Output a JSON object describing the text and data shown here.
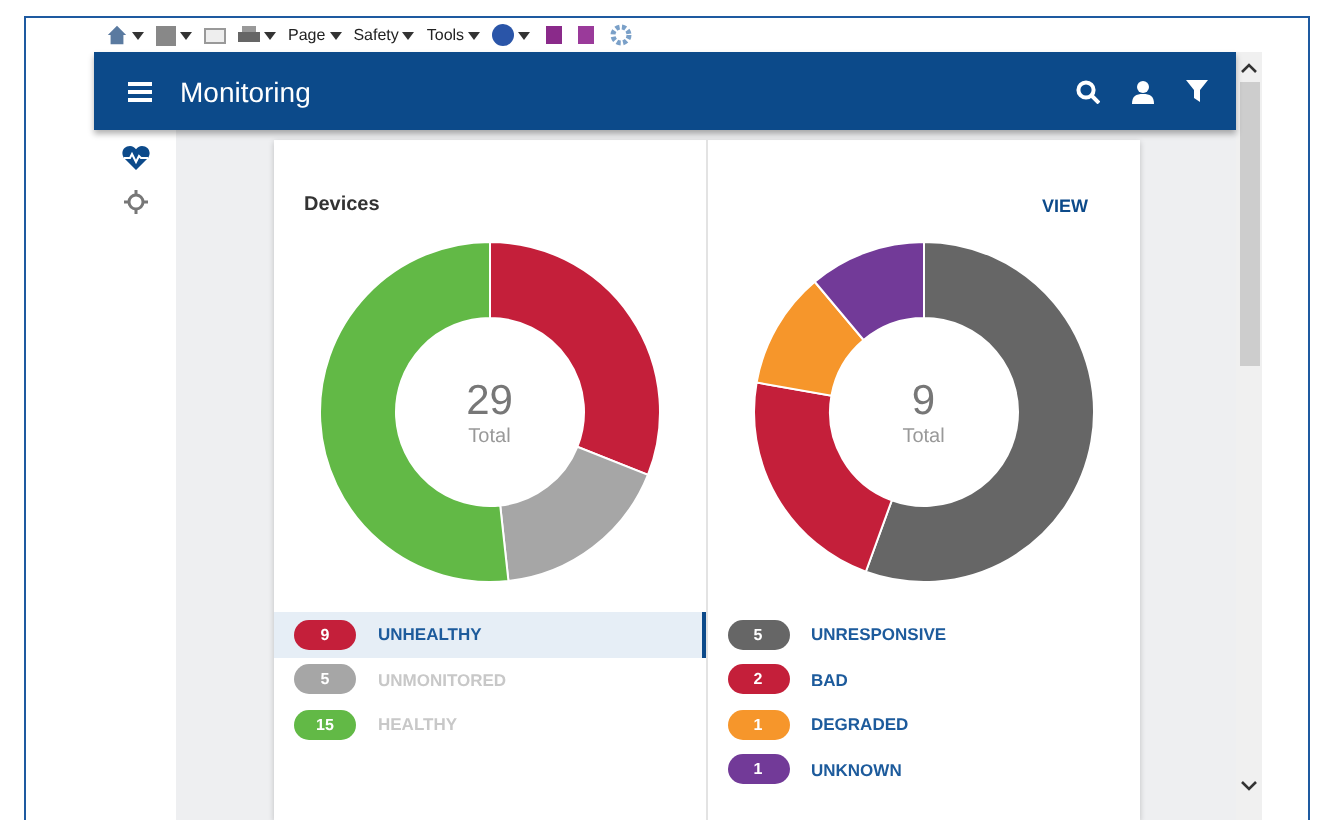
{
  "browser_toolbar": {
    "menus": [
      "Page",
      "Safety",
      "Tools"
    ]
  },
  "header": {
    "title": "Monitoring"
  },
  "sidebar": {
    "items": [
      {
        "kind": "heart",
        "selected": true
      },
      {
        "kind": "target",
        "selected": false
      }
    ]
  },
  "card": {
    "title": "Devices",
    "action": "VIEW",
    "panels": [
      {
        "center_value": "29",
        "center_label": "Total",
        "chart_data": {
          "type": "donut",
          "categories": [
            "UNHEALTHY",
            "UNMONITORED",
            "HEALTHY"
          ],
          "values": [
            31.03,
            17.24,
            51.73
          ]
        },
        "legend": [
          {
            "count": "9",
            "color": "#c41f3a",
            "selected": true,
            "muted": false
          },
          {
            "count": "5",
            "color": "#a6a6a6",
            "selected": false,
            "muted": true
          },
          {
            "count": "15",
            "color": "#62b946",
            "selected": false,
            "muted": true
          }
        ]
      },
      {
        "center_value": "9",
        "center_label": "Total",
        "chart_data": {
          "type": "donut",
          "categories": [
            "UNRESPONSIVE",
            "BAD",
            "DEGRADED",
            "UNKNOWN"
          ],
          "values": [
            55.56,
            22.22,
            11.11,
            11.11
          ]
        },
        "legend": [
          {
            "count": "5",
            "color": "#666666",
            "selected": false,
            "muted": false
          },
          {
            "count": "2",
            "color": "#c41f3a",
            "selected": false,
            "muted": false
          },
          {
            "count": "1",
            "color": "#f6962b",
            "selected": false,
            "muted": false
          },
          {
            "count": "1",
            "color": "#723a98",
            "selected": false,
            "muted": false
          }
        ]
      }
    ]
  }
}
